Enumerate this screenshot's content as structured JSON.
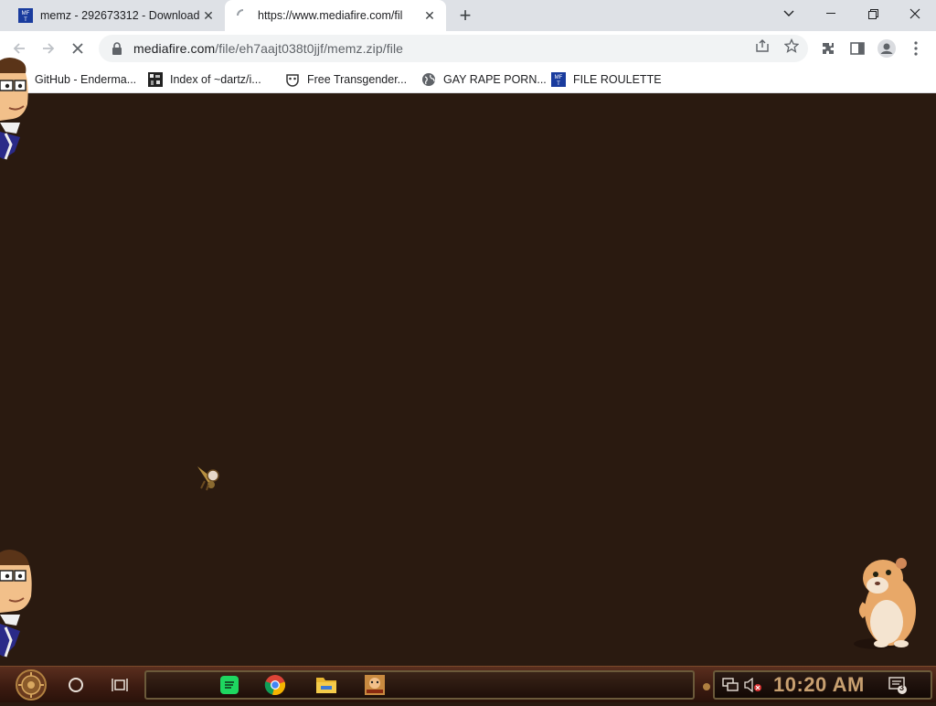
{
  "browser": {
    "tabs": [
      {
        "title": "memz - 292673312 - Download",
        "favicon": "mediafire-icon",
        "active": false
      },
      {
        "title": "https://www.mediafire.com/fil",
        "favicon": "loading-spinner-icon",
        "active": true
      }
    ],
    "address": {
      "host": "mediafire.com",
      "path": "/file/eh7aajt038t0jjf/memz.zip/file"
    },
    "bookmarks": [
      {
        "label": "GitHub - Enderma...",
        "icon": "github-icon"
      },
      {
        "label": "Index of ~dartz/i...",
        "icon": "pixel-icon"
      },
      {
        "label": "Free Transgender...",
        "icon": "mask-icon"
      },
      {
        "label": "GAY RAPE PORN...",
        "icon": "globe-icon"
      },
      {
        "label": "FILE ROULETTE",
        "icon": "mediafire-icon"
      }
    ]
  },
  "taskbar": {
    "clock": "10:20 AM",
    "notification_count": "3",
    "pinned": [
      "search",
      "task-view",
      "spotify",
      "chrome",
      "file-explorer",
      "game"
    ]
  }
}
